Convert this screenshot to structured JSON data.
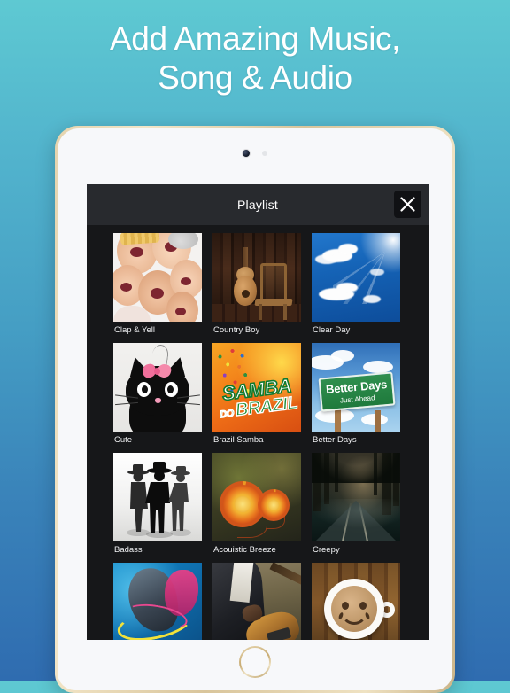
{
  "headline": {
    "line1": "Add Amazing Music,",
    "line2": "Song & Audio"
  },
  "colors": {
    "bg_top": "#5ec9d2",
    "bg_bottom": "#2f6cb0",
    "panel_bg": "#161719",
    "header_bg": "#282a2e",
    "label_text": "#f0f1f3",
    "device_frame": "#e4d3ad"
  },
  "device": {
    "camera_dot": "camera-dot",
    "sensor_dot": "sensor-dot",
    "home_button": "home-button"
  },
  "app": {
    "header": {
      "title": "Playlist",
      "close_label": "close-icon"
    },
    "grid": {
      "rows": [
        [
          {
            "label": "Clap & Yell",
            "art": "art-clap"
          },
          {
            "label": "Country Boy",
            "art": "art-country"
          },
          {
            "label": "Clear Day",
            "art": "art-clearday"
          }
        ],
        [
          {
            "label": "Cute",
            "art": "art-cute"
          },
          {
            "label": "Brazil Samba",
            "art": "art-samba"
          },
          {
            "label": "Better Days",
            "art": "art-better"
          }
        ],
        [
          {
            "label": "Badass",
            "art": "art-badass"
          },
          {
            "label": "Acouistic Breeze",
            "art": "art-acoustic"
          },
          {
            "label": "Creepy",
            "art": "art-creepy"
          }
        ],
        [
          {
            "label": "",
            "art": "art-abstract"
          },
          {
            "label": "",
            "art": "art-player"
          },
          {
            "label": "",
            "art": "art-coffee"
          }
        ]
      ]
    }
  },
  "artwork_text": {
    "samba_line1": "SAMBA",
    "samba_do": "DO ",
    "samba_line2": "BRAZIL",
    "better_days_line1": "Better Days",
    "better_days_line2": "Just Ahead"
  }
}
